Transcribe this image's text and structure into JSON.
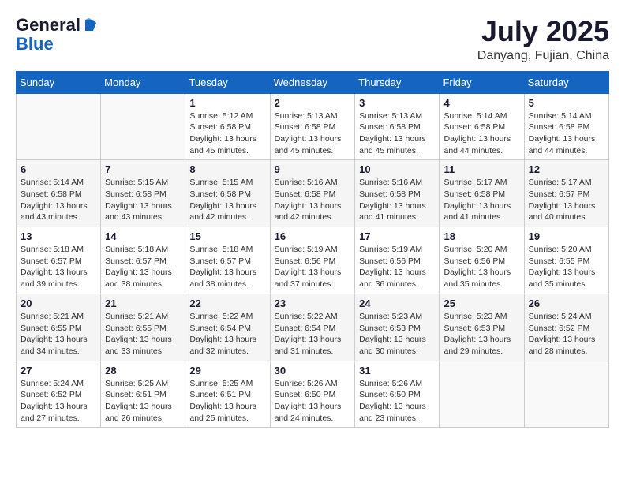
{
  "header": {
    "logo_general": "General",
    "logo_blue": "Blue",
    "month_year": "July 2025",
    "location": "Danyang, Fujian, China"
  },
  "days_of_week": [
    "Sunday",
    "Monday",
    "Tuesday",
    "Wednesday",
    "Thursday",
    "Friday",
    "Saturday"
  ],
  "weeks": [
    [
      {
        "day": "",
        "info": ""
      },
      {
        "day": "",
        "info": ""
      },
      {
        "day": "1",
        "info": "Sunrise: 5:12 AM\nSunset: 6:58 PM\nDaylight: 13 hours and 45 minutes."
      },
      {
        "day": "2",
        "info": "Sunrise: 5:13 AM\nSunset: 6:58 PM\nDaylight: 13 hours and 45 minutes."
      },
      {
        "day": "3",
        "info": "Sunrise: 5:13 AM\nSunset: 6:58 PM\nDaylight: 13 hours and 45 minutes."
      },
      {
        "day": "4",
        "info": "Sunrise: 5:14 AM\nSunset: 6:58 PM\nDaylight: 13 hours and 44 minutes."
      },
      {
        "day": "5",
        "info": "Sunrise: 5:14 AM\nSunset: 6:58 PM\nDaylight: 13 hours and 44 minutes."
      }
    ],
    [
      {
        "day": "6",
        "info": "Sunrise: 5:14 AM\nSunset: 6:58 PM\nDaylight: 13 hours and 43 minutes."
      },
      {
        "day": "7",
        "info": "Sunrise: 5:15 AM\nSunset: 6:58 PM\nDaylight: 13 hours and 43 minutes."
      },
      {
        "day": "8",
        "info": "Sunrise: 5:15 AM\nSunset: 6:58 PM\nDaylight: 13 hours and 42 minutes."
      },
      {
        "day": "9",
        "info": "Sunrise: 5:16 AM\nSunset: 6:58 PM\nDaylight: 13 hours and 42 minutes."
      },
      {
        "day": "10",
        "info": "Sunrise: 5:16 AM\nSunset: 6:58 PM\nDaylight: 13 hours and 41 minutes."
      },
      {
        "day": "11",
        "info": "Sunrise: 5:17 AM\nSunset: 6:58 PM\nDaylight: 13 hours and 41 minutes."
      },
      {
        "day": "12",
        "info": "Sunrise: 5:17 AM\nSunset: 6:57 PM\nDaylight: 13 hours and 40 minutes."
      }
    ],
    [
      {
        "day": "13",
        "info": "Sunrise: 5:18 AM\nSunset: 6:57 PM\nDaylight: 13 hours and 39 minutes."
      },
      {
        "day": "14",
        "info": "Sunrise: 5:18 AM\nSunset: 6:57 PM\nDaylight: 13 hours and 38 minutes."
      },
      {
        "day": "15",
        "info": "Sunrise: 5:18 AM\nSunset: 6:57 PM\nDaylight: 13 hours and 38 minutes."
      },
      {
        "day": "16",
        "info": "Sunrise: 5:19 AM\nSunset: 6:56 PM\nDaylight: 13 hours and 37 minutes."
      },
      {
        "day": "17",
        "info": "Sunrise: 5:19 AM\nSunset: 6:56 PM\nDaylight: 13 hours and 36 minutes."
      },
      {
        "day": "18",
        "info": "Sunrise: 5:20 AM\nSunset: 6:56 PM\nDaylight: 13 hours and 35 minutes."
      },
      {
        "day": "19",
        "info": "Sunrise: 5:20 AM\nSunset: 6:55 PM\nDaylight: 13 hours and 35 minutes."
      }
    ],
    [
      {
        "day": "20",
        "info": "Sunrise: 5:21 AM\nSunset: 6:55 PM\nDaylight: 13 hours and 34 minutes."
      },
      {
        "day": "21",
        "info": "Sunrise: 5:21 AM\nSunset: 6:55 PM\nDaylight: 13 hours and 33 minutes."
      },
      {
        "day": "22",
        "info": "Sunrise: 5:22 AM\nSunset: 6:54 PM\nDaylight: 13 hours and 32 minutes."
      },
      {
        "day": "23",
        "info": "Sunrise: 5:22 AM\nSunset: 6:54 PM\nDaylight: 13 hours and 31 minutes."
      },
      {
        "day": "24",
        "info": "Sunrise: 5:23 AM\nSunset: 6:53 PM\nDaylight: 13 hours and 30 minutes."
      },
      {
        "day": "25",
        "info": "Sunrise: 5:23 AM\nSunset: 6:53 PM\nDaylight: 13 hours and 29 minutes."
      },
      {
        "day": "26",
        "info": "Sunrise: 5:24 AM\nSunset: 6:52 PM\nDaylight: 13 hours and 28 minutes."
      }
    ],
    [
      {
        "day": "27",
        "info": "Sunrise: 5:24 AM\nSunset: 6:52 PM\nDaylight: 13 hours and 27 minutes."
      },
      {
        "day": "28",
        "info": "Sunrise: 5:25 AM\nSunset: 6:51 PM\nDaylight: 13 hours and 26 minutes."
      },
      {
        "day": "29",
        "info": "Sunrise: 5:25 AM\nSunset: 6:51 PM\nDaylight: 13 hours and 25 minutes."
      },
      {
        "day": "30",
        "info": "Sunrise: 5:26 AM\nSunset: 6:50 PM\nDaylight: 13 hours and 24 minutes."
      },
      {
        "day": "31",
        "info": "Sunrise: 5:26 AM\nSunset: 6:50 PM\nDaylight: 13 hours and 23 minutes."
      },
      {
        "day": "",
        "info": ""
      },
      {
        "day": "",
        "info": ""
      }
    ]
  ]
}
